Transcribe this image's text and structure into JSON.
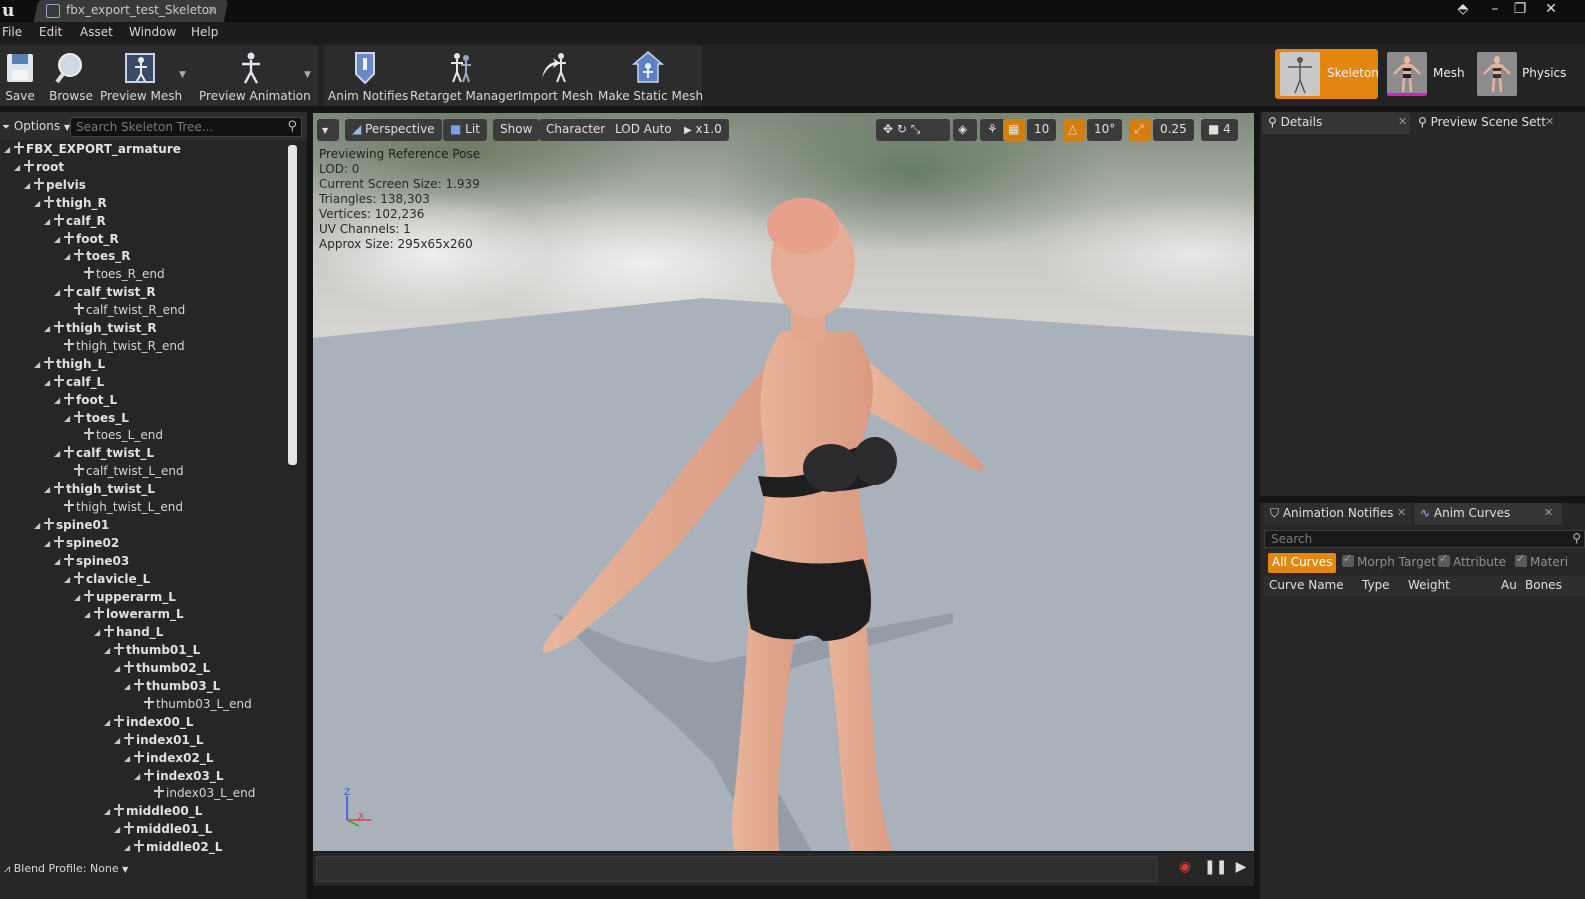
{
  "window": {
    "tab_title": "fbx_export_test_Skeleton",
    "tab_close": "×"
  },
  "menu": [
    "File",
    "Edit",
    "Asset",
    "Window",
    "Help"
  ],
  "toolbar": {
    "save": "Save",
    "browse": "Browse",
    "preview_mesh": "Preview Mesh",
    "preview_animation": "Preview Animation",
    "anim_notifies": "Anim Notifies",
    "retarget_manager": "Retarget Manager",
    "import_mesh": "Import Mesh",
    "make_static_mesh": "Make Static Mesh"
  },
  "modes": {
    "skeleton": "Skeleton",
    "mesh": "Mesh",
    "physics": "Physics",
    "active": "Skeleton"
  },
  "skeleton_tree": {
    "options_label": "Options",
    "search_placeholder": "Search Skeleton Tree...",
    "blend_profile": "Blend Profile: None",
    "bones": [
      {
        "name": "FBX_EXPORT_armature",
        "depth": 0,
        "expanded": true
      },
      {
        "name": "root",
        "depth": 1,
        "expanded": true
      },
      {
        "name": "pelvis",
        "depth": 2,
        "expanded": true
      },
      {
        "name": "thigh_R",
        "depth": 3,
        "expanded": true
      },
      {
        "name": "calf_R",
        "depth": 4,
        "expanded": true
      },
      {
        "name": "foot_R",
        "depth": 5,
        "expanded": true
      },
      {
        "name": "toes_R",
        "depth": 6,
        "expanded": true
      },
      {
        "name": "toes_R_end",
        "depth": 7,
        "leaf": true
      },
      {
        "name": "calf_twist_R",
        "depth": 5,
        "expanded": true
      },
      {
        "name": "calf_twist_R_end",
        "depth": 6,
        "leaf": true
      },
      {
        "name": "thigh_twist_R",
        "depth": 4,
        "expanded": true
      },
      {
        "name": "thigh_twist_R_end",
        "depth": 5,
        "leaf": true
      },
      {
        "name": "thigh_L",
        "depth": 3,
        "expanded": true
      },
      {
        "name": "calf_L",
        "depth": 4,
        "expanded": true
      },
      {
        "name": "foot_L",
        "depth": 5,
        "expanded": true
      },
      {
        "name": "toes_L",
        "depth": 6,
        "expanded": true
      },
      {
        "name": "toes_L_end",
        "depth": 7,
        "leaf": true
      },
      {
        "name": "calf_twist_L",
        "depth": 5,
        "expanded": true
      },
      {
        "name": "calf_twist_L_end",
        "depth": 6,
        "leaf": true
      },
      {
        "name": "thigh_twist_L",
        "depth": 4,
        "expanded": true
      },
      {
        "name": "thigh_twist_L_end",
        "depth": 5,
        "leaf": true
      },
      {
        "name": "spine01",
        "depth": 3,
        "expanded": true
      },
      {
        "name": "spine02",
        "depth": 4,
        "expanded": true
      },
      {
        "name": "spine03",
        "depth": 5,
        "expanded": true
      },
      {
        "name": "clavicle_L",
        "depth": 6,
        "expanded": true
      },
      {
        "name": "upperarm_L",
        "depth": 7,
        "expanded": true
      },
      {
        "name": "lowerarm_L",
        "depth": 8,
        "expanded": true
      },
      {
        "name": "hand_L",
        "depth": 9,
        "expanded": true
      },
      {
        "name": "thumb01_L",
        "depth": 10,
        "expanded": true
      },
      {
        "name": "thumb02_L",
        "depth": 11,
        "expanded": true
      },
      {
        "name": "thumb03_L",
        "depth": 12,
        "expanded": true
      },
      {
        "name": "thumb03_L_end",
        "depth": 13,
        "leaf": true
      },
      {
        "name": "index00_L",
        "depth": 10,
        "expanded": true
      },
      {
        "name": "index01_L",
        "depth": 11,
        "expanded": true
      },
      {
        "name": "index02_L",
        "depth": 12,
        "expanded": true
      },
      {
        "name": "index03_L",
        "depth": 13,
        "expanded": true
      },
      {
        "name": "index03_L_end",
        "depth": 14,
        "leaf": true
      },
      {
        "name": "middle00_L",
        "depth": 10,
        "expanded": true
      },
      {
        "name": "middle01_L",
        "depth": 11,
        "expanded": true
      },
      {
        "name": "middle02_L",
        "depth": 12,
        "expanded": true
      }
    ]
  },
  "viewport": {
    "perspective": "Perspective",
    "lit": "Lit",
    "show": "Show",
    "character": "Character",
    "lod": "LOD Auto",
    "speed": "x1.0",
    "grid_snap": "10",
    "rot_snap": "10°",
    "scale_snap": "0.25",
    "camera_speed": "4",
    "info": [
      "Previewing Reference Pose",
      "LOD: 0",
      "Current Screen Size: 1.939",
      "Triangles: 138,303",
      "Vertices: 102,236",
      "UV Channels: 1",
      "Approx Size: 295x65x260"
    ]
  },
  "details": {
    "tab_details": "Details",
    "tab_preview_scene": "Preview Scene Sett"
  },
  "curves": {
    "tab_notifies": "Animation Notifies",
    "tab_curves": "Anim Curves",
    "search_placeholder": "Search",
    "filters": {
      "all": "All Curves",
      "morph": "Morph Target",
      "attribute": "Attribute",
      "material": "Materi"
    },
    "columns": {
      "name": "Curve Name",
      "type": "Type",
      "weight": "Weight",
      "auto": "Au",
      "bones": "Bones"
    }
  },
  "colors": {
    "accent": "#e3860f",
    "panel": "#262626"
  }
}
